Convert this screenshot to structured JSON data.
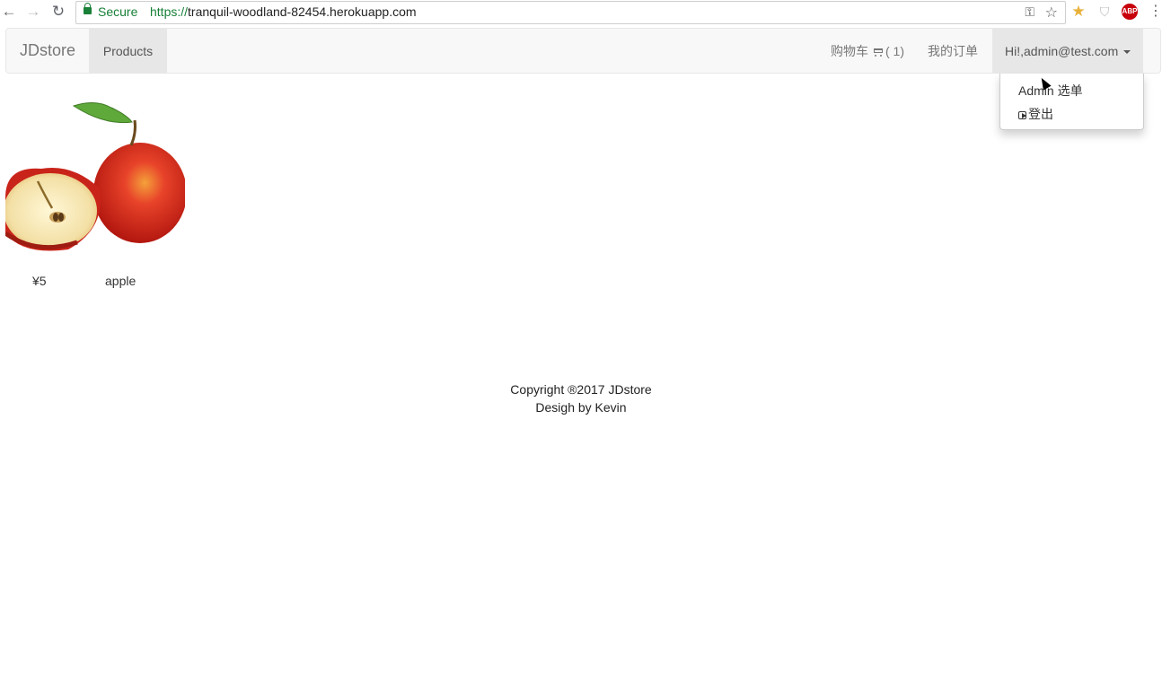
{
  "browser": {
    "secure_label": "Secure",
    "url_scheme": "https://",
    "url_host": "tranquil-woodland-82454.herokuapp.com"
  },
  "navbar": {
    "brand": "JDstore",
    "products_label": "Products",
    "cart_label": "购物车",
    "cart_count": "( 1)",
    "orders_label": "我的订单",
    "user_label": "Hi!,admin@test.com"
  },
  "dropdown": {
    "admin_menu": "Admin 选单",
    "sign_out": "登出"
  },
  "product": {
    "price": "¥5",
    "name": "apple",
    "image_icon": "apple-image"
  },
  "footer": {
    "copyright": "Copyright ®2017 JDstore",
    "design": "Desigh by Kevin"
  },
  "colors": {
    "secure_green": "#188038",
    "navbar_bg": "#f8f8f8",
    "active_bg": "#e7e7e7",
    "apple_red": "#d42a17"
  }
}
